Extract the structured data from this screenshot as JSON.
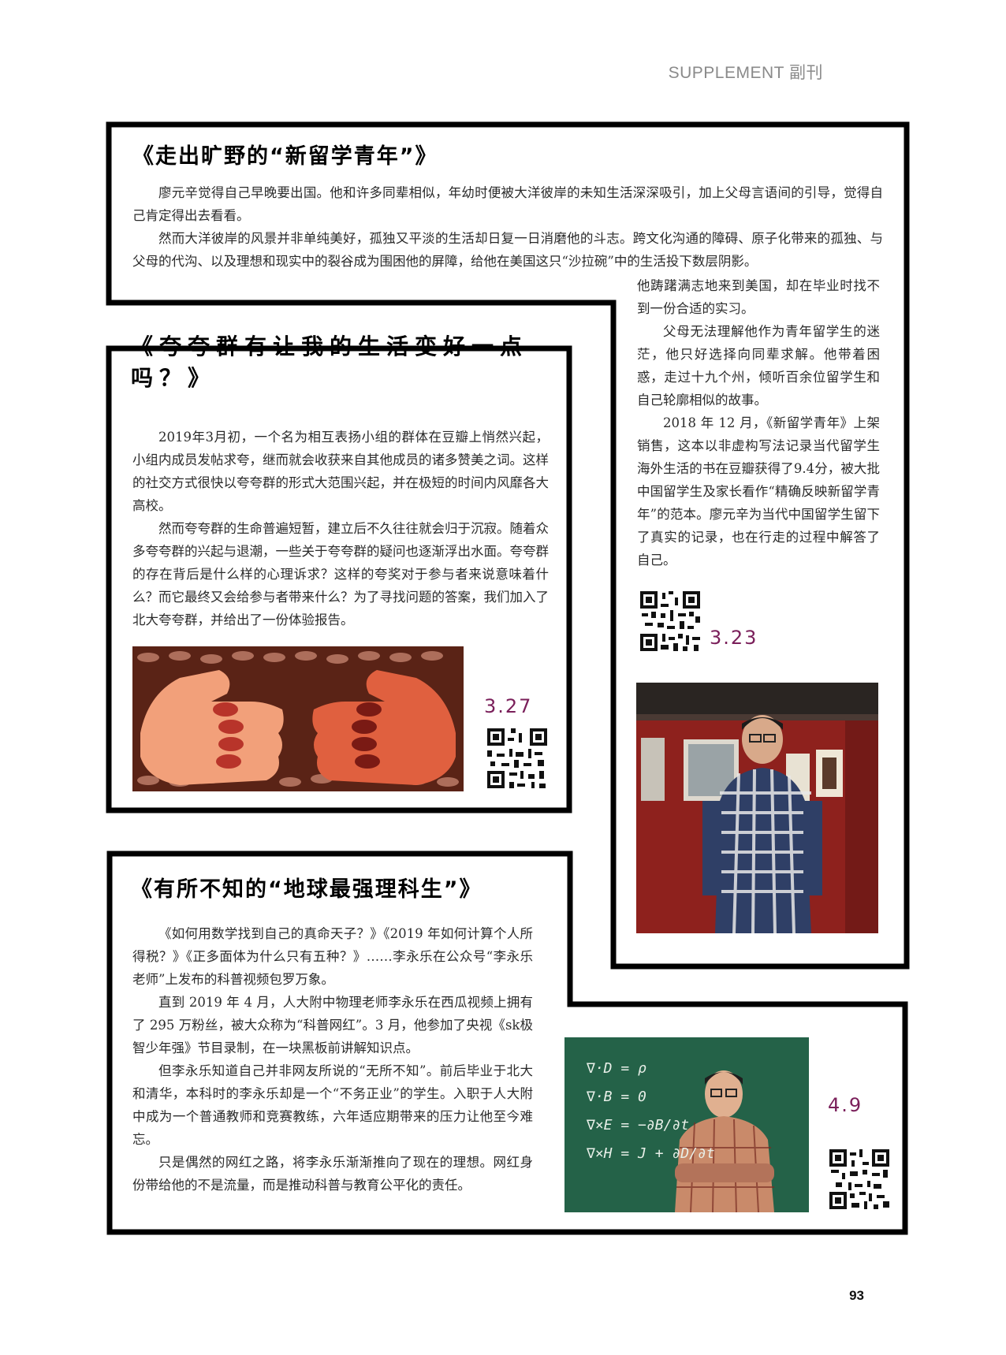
{
  "header": {
    "section_en": "SUPPLEMENT",
    "section_cn": "副刊"
  },
  "page_number": "93",
  "articles": [
    {
      "title": "《走出旷野的“新留学青年”》",
      "paragraphs_top": [
        "廖元辛觉得自己早晚要出国。他和许多同辈相似，年幼时便被大洋彼岸的未知生活深深吸引，加上父母言语间的引导，觉得自己肯定得出去看看。",
        "然而大洋彼岸的风景并非单纯美好，孤独又平淡的生活却日复一日消磨他的斗志。跨文化沟通的障碍、原子化带来的孤独、与父母的代沟、以及理想和现实中的裂谷成为围困他的屏障，给他在美国这只“沙拉碗”中的生活投下数层阴影。"
      ],
      "paragraphs_side": [
        "他踌躇满志地来到美国，却在毕业时找不到一份合适的实习。",
        "父母无法理解他作为青年留学生的迷茫，他只好选择向同辈求解。他带着困惑，走过十九个州，倾听百余位留学生和自己轮廓相似的故事。",
        "2018 年 12 月，《新留学青年》上架销售，这本以非虚构写法记录当代留学生海外生活的书在豆瓣获得了9.4分，被大批中国留学生及家长看作“精确反映新留学青年”的范本。廖元辛为当代中国留学生留下了真实的记录，也在行走的过程中解答了自己。"
      ],
      "date": "3.23"
    },
    {
      "title": "《夸夸群有让我的生活变好一点吗？》",
      "paragraphs": [
        "2019年3月初，一个名为相互表扬小组的群体在豆瓣上悄然兴起，小组内成员发帖求夸，继而就会收获来自其他成员的诸多赞美之词。这样的社交方式很快以夸夸群的形式大范围兴起，并在极短的时间内风靡各大高校。",
        "然而夸夸群的生命普遍短暂，建立后不久往往就会归于沉寂。随着众多夸夸群的兴起与退潮，一些关于夸夸群的疑问也逐渐浮出水面。夸夸群的存在背后是什么样的心理诉求？这样的夸奖对于参与者来说意味着什么？而它最终又会给参与者带来什么？为了寻找问题的答案，我们加入了北大夸夸群，并给出了一份体验报告。"
      ],
      "date": "3.27"
    },
    {
      "title": "《有所不知的“地球最强理科生”》",
      "paragraphs": [
        "《如何用数学找到自己的真命天子？》《2019 年如何计算个人所得税？》《正多面体为什么只有五种？》……李永乐在公众号“李永乐老师”上发布的科普视频包罗万象。",
        "直到 2019 年 4 月，人大附中物理老师李永乐在西瓜视频上拥有了 295 万粉丝，被大众称为“科普网红”。3 月，他参加了央视《sk极智少年强》节目录制，在一块黑板前讲解知识点。",
        "但李永乐知道自己并非网友所说的“无所不知”。前后毕业于北大和清华，本科时的李永乐却是一个“不务正业”的学生。入职于人大附中成为一个普通教师和竞赛教练，六年适应期带来的压力让他至今难忘。",
        "只是偶然的网红之路，将李永乐渐渐推向了现在的理想。网红身份带给他的不是流量，而是推动科普与教育公平化的责任。"
      ],
      "date": "4.9",
      "blackboard": [
        "∇·D = ρ",
        "∇·B = 0",
        "∇×E = −∂B/∂t",
        "∇×H = J + ∂D/∂t"
      ]
    }
  ],
  "colors": {
    "accent_date": "#7a1f5a",
    "frame": "#000000",
    "header": "#8a8a8a"
  }
}
